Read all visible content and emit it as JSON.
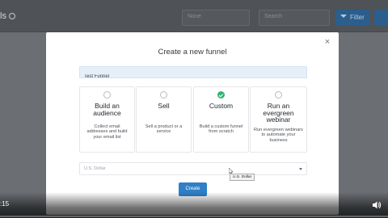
{
  "background_app": {
    "title_fragment": "ls",
    "select_placeholder": "None",
    "search_placeholder": "Search",
    "filter_label": "Filter"
  },
  "modal": {
    "title": "Create a new funnel",
    "close_label": "×",
    "funnel_name_value": "Test Funnel",
    "cards": [
      {
        "title": "Build an audience",
        "description": "Collect email addresses and build your email list",
        "selected": false
      },
      {
        "title": "Sell",
        "description": "Sell a product or a service",
        "selected": false
      },
      {
        "title": "Custom",
        "description": "Build a custom funnel from scratch",
        "selected": true
      },
      {
        "title": "Run an evergreen webinar",
        "description": "Run evergreen webinars to automate your business",
        "selected": false
      }
    ],
    "currency_value": "U.S. Dollar",
    "create_label": "Create",
    "tooltip": "U.S. Dollar"
  },
  "player": {
    "time": ":15"
  },
  "colors": {
    "accent_blue": "#2f7fc6",
    "selected_green": "#2bb673"
  }
}
